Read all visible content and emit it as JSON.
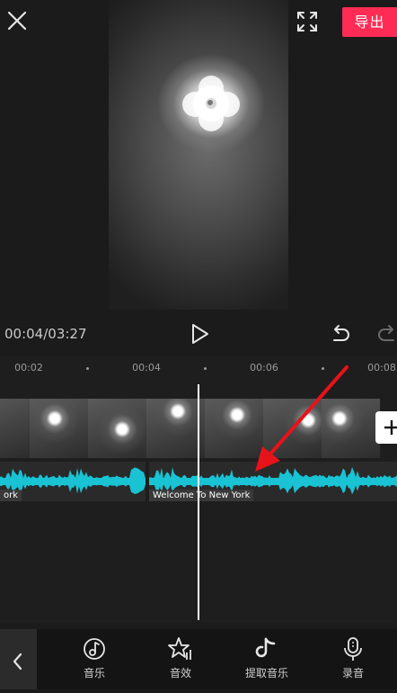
{
  "header": {
    "export_label": "导出",
    "close_icon": "close-icon",
    "fullscreen_icon": "fullscreen-icon"
  },
  "player": {
    "time_current": "00:04",
    "time_total": "03:27",
    "time_display": "00:04/03:27",
    "play_icon": "play-icon",
    "undo_icon": "undo-icon",
    "redo_icon": "redo-icon"
  },
  "timeline": {
    "ruler": [
      "00:02",
      "00:04",
      "00:06",
      "00:08"
    ],
    "audio_clips": [
      {
        "label": "ork"
      },
      {
        "label": "Welcome To New York"
      }
    ]
  },
  "toolbar": {
    "back_icon": "chevron-left-icon",
    "items": [
      {
        "label": "音乐",
        "icon": "music-note-icon"
      },
      {
        "label": "音效",
        "icon": "star-sound-icon"
      },
      {
        "label": "提取音乐",
        "icon": "extract-music-icon"
      },
      {
        "label": "录音",
        "icon": "microphone-icon"
      }
    ]
  },
  "colors": {
    "accent": "#fe2c55",
    "waveform": "#19c3d3",
    "annotation": "#e8121a"
  }
}
